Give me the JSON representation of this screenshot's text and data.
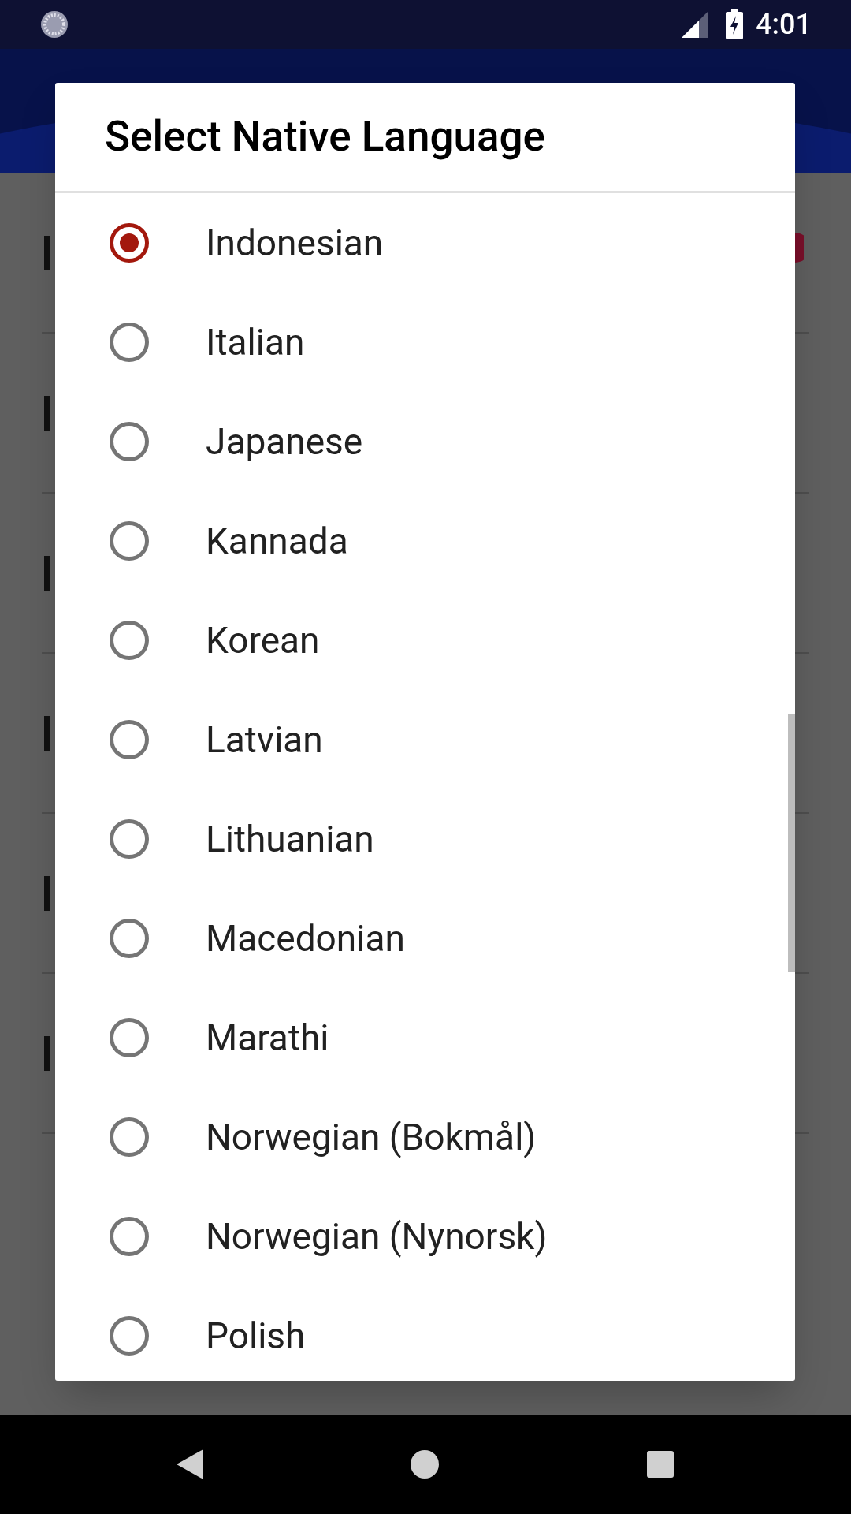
{
  "status_bar": {
    "time": "4:01"
  },
  "dialog": {
    "title": "Select Native Language",
    "options": [
      {
        "label": "Indonesian",
        "selected": true
      },
      {
        "label": "Italian",
        "selected": false
      },
      {
        "label": "Japanese",
        "selected": false
      },
      {
        "label": "Kannada",
        "selected": false
      },
      {
        "label": "Korean",
        "selected": false
      },
      {
        "label": "Latvian",
        "selected": false
      },
      {
        "label": "Lithuanian",
        "selected": false
      },
      {
        "label": "Macedonian",
        "selected": false
      },
      {
        "label": "Marathi",
        "selected": false
      },
      {
        "label": "Norwegian (Bokmål)",
        "selected": false
      },
      {
        "label": "Norwegian (Nynorsk)",
        "selected": false
      },
      {
        "label": "Polish",
        "selected": false
      }
    ]
  }
}
